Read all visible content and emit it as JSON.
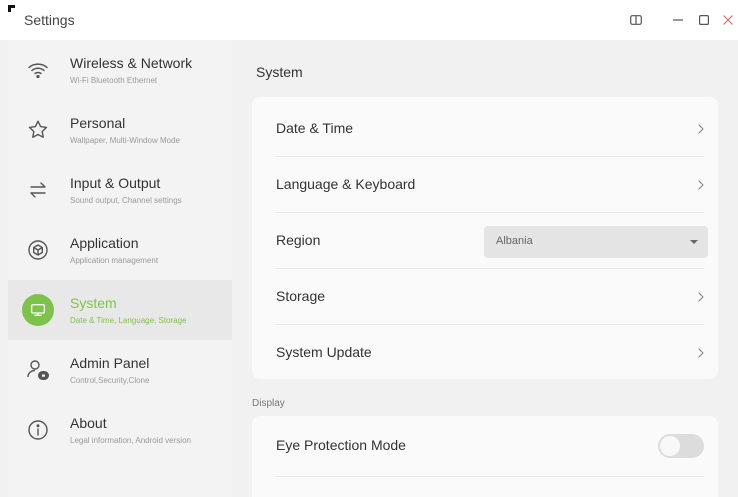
{
  "window": {
    "title": "Settings",
    "controls": [
      "split-view-icon",
      "minimize-icon",
      "maximize-icon",
      "close-icon"
    ]
  },
  "sidebar": {
    "items": [
      {
        "title": "Wireless & Network",
        "subtitle": "Wi-Fi Bluetooth Ethernet",
        "icon": "wifi-icon",
        "active": false
      },
      {
        "title": "Personal",
        "subtitle": "Wallpaper, Multi-Window Mode",
        "icon": "star-icon",
        "active": false
      },
      {
        "title": "Input & Output",
        "subtitle": "Sound output, Channel settings",
        "icon": "arrows-icon",
        "active": false
      },
      {
        "title": "Application",
        "subtitle": "Application management",
        "icon": "cube-icon",
        "active": false
      },
      {
        "title": "System",
        "subtitle": "Date & Time, Language, Storage",
        "icon": "monitor-icon",
        "active": true
      },
      {
        "title": "Admin Panel",
        "subtitle": "Control,Security,Clone",
        "icon": "admin-icon",
        "active": false
      },
      {
        "title": "About",
        "subtitle": "Legal information, Android version",
        "icon": "info-icon",
        "active": false
      }
    ]
  },
  "main": {
    "title": "System",
    "system_rows": {
      "date_time": "Date & Time",
      "language_keyboard": "Language & Keyboard",
      "region": {
        "label": "Region",
        "selected": "Albania"
      },
      "storage": "Storage",
      "system_update": "System Update"
    },
    "display": {
      "section_label": "Display",
      "eye_protection": {
        "label": "Eye Protection Mode",
        "enabled": false
      }
    }
  },
  "colors": {
    "accent": "#7dc24b",
    "background": "#f1f1f1",
    "card": "#fafafa",
    "selected_nav": "#e8e8e8"
  }
}
